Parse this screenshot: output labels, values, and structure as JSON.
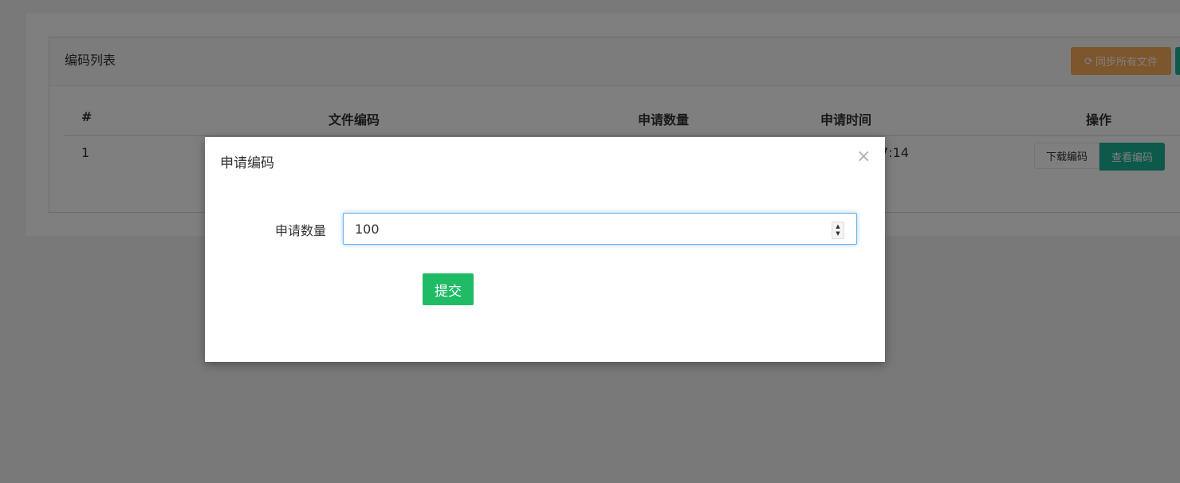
{
  "panel": {
    "title": "编码列表",
    "sync_button_icon": "refresh-icon",
    "sync_button_label": "同步所有文件"
  },
  "table": {
    "headers": [
      "#",
      "文件编码",
      "申请数量",
      "申请时间",
      "操作"
    ],
    "rows": [
      {
        "index": "1",
        "time_visible_fragment": "7:14",
        "download_label": "下载编码",
        "view_label": "查看编码"
      }
    ]
  },
  "modal": {
    "title": "申请编码",
    "close_glyph": "×",
    "quantity_label": "申请数量",
    "quantity_value": "100",
    "submit_label": "提交"
  },
  "colors": {
    "sync_button": "#f8ac59",
    "primary_green": "#1ab394",
    "submit_green": "#1fbc65",
    "input_focus": "#66afe9"
  }
}
